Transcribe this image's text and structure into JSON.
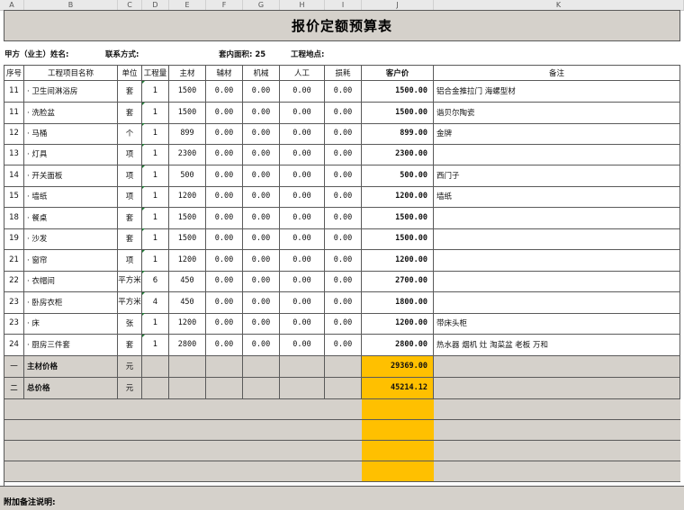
{
  "title": "报价定额预算表",
  "col_letters": [
    "A",
    "B",
    "C",
    "D",
    "E",
    "F",
    "G",
    "H",
    "I",
    "J",
    "K"
  ],
  "info": {
    "owner_label": "甲方（业主）姓名:",
    "contact_label": "联系方式:",
    "area_label": "套内面积:",
    "area_value": "25",
    "site_label": "工程地点:"
  },
  "headers": [
    "序号",
    "工程项目名称",
    "单位",
    "工程量",
    "主材",
    "辅材",
    "机械",
    "人工",
    "损耗",
    "客户价",
    "备注"
  ],
  "rows": [
    {
      "seq": "11",
      "name": "· 卫生间淋浴房",
      "unit": "套",
      "qty": "1",
      "main": "1500",
      "aux": "0.00",
      "mach": "0.00",
      "labor": "0.00",
      "loss": "0.00",
      "price": "1500.00",
      "note": "铝合金推拉门  海螺型材"
    },
    {
      "seq": "11",
      "name": "· 洗脸盆",
      "unit": "套",
      "qty": "1",
      "main": "1500",
      "aux": "0.00",
      "mach": "0.00",
      "labor": "0.00",
      "loss": "0.00",
      "price": "1500.00",
      "note": "谐贝尔陶瓷"
    },
    {
      "seq": "12",
      "name": "· 马桶",
      "unit": "个",
      "qty": "1",
      "main": "899",
      "aux": "0.00",
      "mach": "0.00",
      "labor": "0.00",
      "loss": "0.00",
      "price": "899.00",
      "note": "金牌"
    },
    {
      "seq": "13",
      "name": "· 灯具",
      "unit": "项",
      "qty": "1",
      "main": "2300",
      "aux": "0.00",
      "mach": "0.00",
      "labor": "0.00",
      "loss": "0.00",
      "price": "2300.00",
      "note": ""
    },
    {
      "seq": "14",
      "name": "· 开关面板",
      "unit": "项",
      "qty": "1",
      "main": "500",
      "aux": "0.00",
      "mach": "0.00",
      "labor": "0.00",
      "loss": "0.00",
      "price": "500.00",
      "note": "西门子"
    },
    {
      "seq": "15",
      "name": "· 墙纸",
      "unit": "项",
      "qty": "1",
      "main": "1200",
      "aux": "0.00",
      "mach": "0.00",
      "labor": "0.00",
      "loss": "0.00",
      "price": "1200.00",
      "note": "墙纸"
    },
    {
      "seq": "18",
      "name": "· 餐桌",
      "unit": "套",
      "qty": "1",
      "main": "1500",
      "aux": "0.00",
      "mach": "0.00",
      "labor": "0.00",
      "loss": "0.00",
      "price": "1500.00",
      "note": ""
    },
    {
      "seq": "19",
      "name": "· 沙发",
      "unit": "套",
      "qty": "1",
      "main": "1500",
      "aux": "0.00",
      "mach": "0.00",
      "labor": "0.00",
      "loss": "0.00",
      "price": "1500.00",
      "note": ""
    },
    {
      "seq": "21",
      "name": "· 窗帘",
      "unit": "项",
      "qty": "1",
      "main": "1200",
      "aux": "0.00",
      "mach": "0.00",
      "labor": "0.00",
      "loss": "0.00",
      "price": "1200.00",
      "note": ""
    },
    {
      "seq": "22",
      "name": "· 衣帽间",
      "unit": "平方米",
      "qty": "6",
      "main": "450",
      "aux": "0.00",
      "mach": "0.00",
      "labor": "0.00",
      "loss": "0.00",
      "price": "2700.00",
      "note": ""
    },
    {
      "seq": "23",
      "name": "· 卧房衣柜",
      "unit": "平方米",
      "qty": "4",
      "main": "450",
      "aux": "0.00",
      "mach": "0.00",
      "labor": "0.00",
      "loss": "0.00",
      "price": "1800.00",
      "note": ""
    },
    {
      "seq": "23",
      "name": "· 床",
      "unit": "张",
      "qty": "1",
      "main": "1200",
      "aux": "0.00",
      "mach": "0.00",
      "labor": "0.00",
      "loss": "0.00",
      "price": "1200.00",
      "note": "带床头柜"
    },
    {
      "seq": "24",
      "name": "· 厨房三件套",
      "unit": "套",
      "qty": "1",
      "main": "2800",
      "aux": "0.00",
      "mach": "0.00",
      "labor": "0.00",
      "loss": "0.00",
      "price": "2800.00",
      "note": "热水器    烟机    灶    淘菜盆  老板    万和"
    }
  ],
  "totals": [
    {
      "seq": "一",
      "name": "主材价格",
      "unit": "元",
      "price": "29369.00"
    },
    {
      "seq": "二",
      "name": "总价格",
      "unit": "元",
      "price": "45214.12"
    }
  ],
  "footer": "附加备注说明:",
  "colors": {
    "header_gray": "#d5d1cb",
    "highlight": "#ffc000",
    "grid": "#5a5a5a"
  }
}
